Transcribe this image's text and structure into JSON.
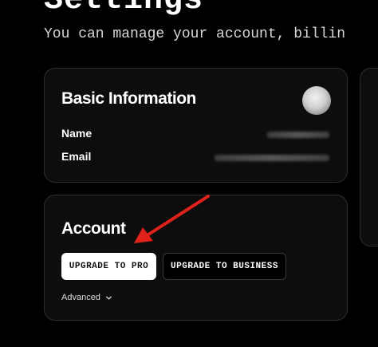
{
  "header": {
    "title": "Settings",
    "subtitle": "You can manage your account, billin"
  },
  "basic_info": {
    "title": "Basic Information",
    "avatar_icon": "user-avatar",
    "name_label": "Name",
    "email_label": "Email"
  },
  "account": {
    "title": "Account",
    "upgrade_pro_label": "UPGRADE TO PRO",
    "upgrade_business_label": "UPGRADE TO BUSINESS",
    "advanced_label": "Advanced",
    "advanced_icon": "chevron-down-icon"
  },
  "annotation": {
    "arrow_color": "#e0221b"
  }
}
